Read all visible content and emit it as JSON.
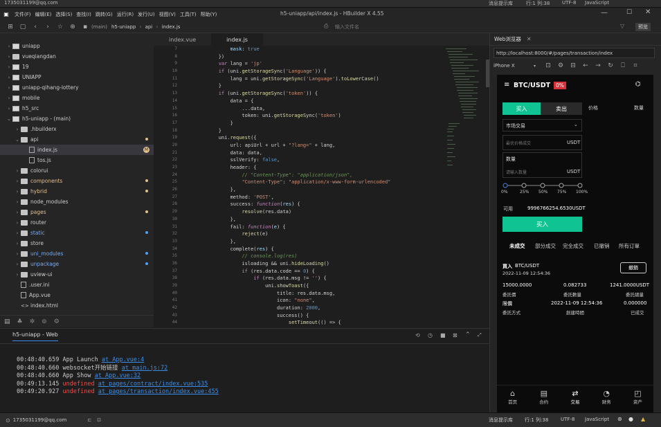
{
  "titlebar": {
    "left_text": "1735031199@qq.com",
    "hint": "消息提示库",
    "pos": "行:1  列:38",
    "encoding": "UTF-8",
    "lang": "JavaScript"
  },
  "menu": {
    "items": [
      "文件(F)",
      "编辑(E)",
      "选择(S)",
      "查找(I)",
      "跳转(G)",
      "运行(R)",
      "发行(U)",
      "视图(V)",
      "工具(T)",
      "帮助(Y)"
    ],
    "window_title": "h5-uniapp/api/index.js - HBuilder X 4.55"
  },
  "toolbar": {
    "crumbs": [
      "(main)",
      "h5-uniapp",
      "api",
      "index.js"
    ],
    "search_placeholder": "输入文件名",
    "right_btn": "预览"
  },
  "tree": [
    {
      "label": "uniapp",
      "depth": 0,
      "open": false,
      "type": "project"
    },
    {
      "label": "vueqiangdan",
      "depth": 0,
      "open": false,
      "type": "folder"
    },
    {
      "label": "19",
      "depth": 0,
      "open": false,
      "type": "project"
    },
    {
      "label": "UNIAPP",
      "depth": 0,
      "open": false,
      "type": "project"
    },
    {
      "label": "uniapp-qihang-lottery",
      "depth": 0,
      "open": false,
      "type": "project"
    },
    {
      "label": "mobile",
      "depth": 0,
      "open": false,
      "type": "project"
    },
    {
      "label": "h5_src",
      "depth": 0,
      "open": false,
      "type": "project"
    },
    {
      "label": "h5-uniapp - (main)",
      "depth": 0,
      "open": true,
      "type": "project"
    },
    {
      "label": ".hbuilderx",
      "depth": 1,
      "open": false,
      "type": "folder"
    },
    {
      "label": "api",
      "depth": 1,
      "open": true,
      "type": "folder",
      "dot": "#e2c08d"
    },
    {
      "label": "index.js",
      "depth": 2,
      "type": "file",
      "selected": true,
      "badge": "M"
    },
    {
      "label": "tos.js",
      "depth": 2,
      "type": "file"
    },
    {
      "label": "colorui",
      "depth": 1,
      "open": false,
      "type": "folder"
    },
    {
      "label": "components",
      "depth": 1,
      "open": false,
      "type": "folder",
      "dot": "#e2c08d",
      "color": "#e2c08d"
    },
    {
      "label": "hybrid",
      "depth": 1,
      "open": false,
      "type": "folder",
      "dot": "#e2c08d",
      "color": "#e2c08d"
    },
    {
      "label": "node_modules",
      "depth": 1,
      "open": false,
      "type": "folder"
    },
    {
      "label": "pages",
      "depth": 1,
      "open": false,
      "type": "folder",
      "dot": "#e2c08d",
      "color": "#e2c08d"
    },
    {
      "label": "router",
      "depth": 1,
      "open": false,
      "type": "folder"
    },
    {
      "label": "static",
      "depth": 1,
      "open": false,
      "type": "folder",
      "dot": "#4ea1f3",
      "color": "#7aaaf0"
    },
    {
      "label": "store",
      "depth": 1,
      "open": false,
      "type": "folder"
    },
    {
      "label": "uni_modules",
      "depth": 1,
      "open": false,
      "type": "folder",
      "dot": "#4ea1f3",
      "color": "#7aaaf0"
    },
    {
      "label": "unpackage",
      "depth": 1,
      "open": false,
      "type": "folder",
      "dot": "#4ea1f3",
      "color": "#7aaaf0"
    },
    {
      "label": "uview-ui",
      "depth": 1,
      "open": false,
      "type": "folder"
    },
    {
      "label": ".user.ini",
      "depth": 1,
      "type": "file"
    },
    {
      "label": "App.vue",
      "depth": 1,
      "type": "file"
    },
    {
      "label": "index.html",
      "depth": 1,
      "type": "html"
    }
  ],
  "tabs": [
    "index.vue",
    "index.js"
  ],
  "code": {
    "line_numbers": [
      "7",
      "8",
      "9",
      "10",
      "11",
      "12",
      "13",
      "14",
      "15",
      "16",
      "17",
      "18",
      "19",
      "20",
      "21",
      "22",
      "23",
      "24",
      "25",
      "26",
      "27",
      "28",
      "29",
      "30",
      "31",
      "32",
      "33",
      "34",
      "35",
      "36",
      "37",
      "38",
      "39",
      "40",
      "41",
      "42",
      "43",
      "44"
    ],
    "lines": [
      [
        [
          "            ",
          "p"
        ],
        [
          "mask",
          "k"
        ],
        [
          ": ",
          "p"
        ],
        [
          "true",
          "n"
        ]
      ],
      [
        [
          "        })",
          "p"
        ]
      ],
      [
        [
          "        ",
          "p"
        ],
        [
          "var",
          "k2"
        ],
        [
          " lang = ",
          "p"
        ],
        [
          "'jp'",
          "s"
        ]
      ],
      [
        [
          "        ",
          "p"
        ],
        [
          "if",
          "k2"
        ],
        [
          " (uni.",
          "p"
        ],
        [
          "getStorageSync",
          "f"
        ],
        [
          "(",
          "p"
        ],
        [
          "'Language'",
          "s"
        ],
        [
          ")) {",
          "p"
        ]
      ],
      [
        [
          "            lang = uni.",
          "p"
        ],
        [
          "getStorageSync",
          "f"
        ],
        [
          "(",
          "p"
        ],
        [
          "'Language'",
          "s"
        ],
        [
          ").",
          "p"
        ],
        [
          "toLowerCase",
          "f"
        ],
        [
          "()",
          "p"
        ]
      ],
      [
        [
          "        }",
          "p"
        ]
      ],
      [
        [
          "        ",
          "p"
        ],
        [
          "if",
          "k2"
        ],
        [
          " (uni.",
          "p"
        ],
        [
          "getStorageSync",
          "f"
        ],
        [
          "(",
          "p"
        ],
        [
          "'token'",
          "s"
        ],
        [
          ")) {",
          "p"
        ]
      ],
      [
        [
          "            data = {",
          "p"
        ]
      ],
      [
        [
          "                ...data,",
          "p"
        ]
      ],
      [
        [
          "                token: uni.",
          "p"
        ],
        [
          "getStorageSync",
          "f"
        ],
        [
          "(",
          "p"
        ],
        [
          "'token'",
          "s"
        ],
        [
          ")",
          "p"
        ]
      ],
      [
        [
          "            }",
          "p"
        ]
      ],
      [
        [
          "        }",
          "p"
        ]
      ],
      [
        [
          "        uni.",
          "p"
        ],
        [
          "request",
          "f"
        ],
        [
          "({",
          "p"
        ]
      ],
      [
        [
          "            url: apiUrl + url + ",
          "p"
        ],
        [
          "\"?lang=\"",
          "s"
        ],
        [
          " + lang,",
          "p"
        ]
      ],
      [
        [
          "            data: data,",
          "p"
        ]
      ],
      [
        [
          "            sslVerify: ",
          "p"
        ],
        [
          "false",
          "n"
        ],
        [
          ",",
          "p"
        ]
      ],
      [
        [
          "            header: {",
          "p"
        ]
      ],
      [
        [
          "                ",
          "p"
        ],
        [
          "// \"Content-Type\": \"application/json\",",
          "c"
        ]
      ],
      [
        [
          "                ",
          "p"
        ],
        [
          "\"Content-Type\"",
          "s"
        ],
        [
          ": ",
          "p"
        ],
        [
          "\"application/x-www-form-urlencoded\"",
          "s"
        ]
      ],
      [
        [
          "            },",
          "p"
        ]
      ],
      [
        [
          "            method: ",
          "p"
        ],
        [
          "'POST'",
          "s"
        ],
        [
          ",",
          "p"
        ]
      ],
      [
        [
          "            success: ",
          "p"
        ],
        [
          "function",
          "k2"
        ],
        [
          "(",
          "p"
        ],
        [
          "res",
          "v"
        ],
        [
          ") {",
          "p"
        ]
      ],
      [
        [
          "                ",
          "p"
        ],
        [
          "resolve",
          "f"
        ],
        [
          "(res.data)",
          "p"
        ]
      ],
      [
        [
          "            },",
          "p"
        ]
      ],
      [
        [
          "            fail: ",
          "p"
        ],
        [
          "function",
          "k2"
        ],
        [
          "(",
          "p"
        ],
        [
          "e",
          "v"
        ],
        [
          ") {",
          "p"
        ]
      ],
      [
        [
          "                ",
          "p"
        ],
        [
          "reject",
          "f"
        ],
        [
          "(e)",
          "p"
        ]
      ],
      [
        [
          "            },",
          "p"
        ]
      ],
      [
        [
          "            complete(",
          "p"
        ],
        [
          "res",
          "v"
        ],
        [
          ") {",
          "p"
        ]
      ],
      [
        [
          "                ",
          "p"
        ],
        [
          "// console.log(res)",
          "c"
        ]
      ],
      [
        [
          "                isloading && uni.",
          "p"
        ],
        [
          "hideLoading",
          "f"
        ],
        [
          "()",
          "p"
        ]
      ],
      [
        [
          "                ",
          "p"
        ],
        [
          "if",
          "k2"
        ],
        [
          " (res.data.code == ",
          "p"
        ],
        [
          "0",
          "n"
        ],
        [
          ") {",
          "p"
        ]
      ],
      [
        [
          "                    ",
          "p"
        ],
        [
          "if",
          "k2"
        ],
        [
          " (res.data.msg != ",
          "p"
        ],
        [
          "''",
          "s"
        ],
        [
          ") {",
          "p"
        ]
      ],
      [
        [
          "                        uni.",
          "p"
        ],
        [
          "showToast",
          "f"
        ],
        [
          "({",
          "p"
        ]
      ],
      [
        [
          "                            title: res.data.msg,",
          "p"
        ]
      ],
      [
        [
          "                            icon: ",
          "p"
        ],
        [
          "\"none\"",
          "s"
        ],
        [
          ",",
          "p"
        ]
      ],
      [
        [
          "                            duration: ",
          "p"
        ],
        [
          "2000",
          "n"
        ],
        [
          ",",
          "p"
        ]
      ],
      [
        [
          "                            success() {",
          "p"
        ]
      ],
      [
        [
          "                                ",
          "p"
        ],
        [
          "setTimeout",
          "f"
        ],
        [
          "(() => {",
          "p"
        ]
      ]
    ]
  },
  "console": {
    "title": "h5-uniapp - Web",
    "logs": [
      {
        "time": "00:48:40.659",
        "msg": "App Launch",
        "link": "at App.vue:4",
        "err": false
      },
      {
        "time": "00:48:40.660",
        "msg": "websocket开始链接",
        "link": "at main.js:72",
        "err": false
      },
      {
        "time": "00:48:40.660",
        "msg": "App Show",
        "link": "at App.vue:32",
        "err": false
      },
      {
        "time": "00:49:13.145",
        "msg": "undefined",
        "link": "at pages/contract/index.vue:535",
        "err": true
      },
      {
        "time": "00:49:20.927",
        "msg": "undefined",
        "link": "at pages/transaction/index.vue:455",
        "err": true
      }
    ]
  },
  "browser": {
    "tab": "Web浏览器",
    "url": "http://localhost:8000/#/pages/transaction/index",
    "device": "iPhone X"
  },
  "phone": {
    "pair": "BTC/USDT",
    "change": "0%",
    "buy_tab": "买入",
    "sell_tab": "卖出",
    "col_price": "价格",
    "col_qty": "数量",
    "order_type": "市场交易",
    "price_placeholder": "最优价格成交",
    "price_unit": "USDT",
    "qty_label": "数量",
    "qty_placeholder": "请输入数量",
    "qty_unit": "USDT",
    "percents": [
      "0%",
      "25%",
      "50%",
      "75%",
      "100%"
    ],
    "avail_label": "可用",
    "avail_value": "9996766254.6530USDT",
    "submit": "买入",
    "order_tabs": [
      "未成交",
      "部分成交",
      "完全成交",
      "已撤销",
      "所有订單"
    ],
    "order": {
      "side": "買入",
      "pair": "BTC/USDT",
      "time": "2022-11-09 12:54:36",
      "cancel": "撤銷",
      "v1": "15000.0000",
      "l1": "委託價",
      "v2": "0.082733",
      "l2": "委託數量",
      "v3": "1241.0000USDT",
      "l3": "委託總量",
      "v4": "限價",
      "l4": "委託方式",
      "v5": "2022-11-09 12:54:36",
      "l5": "創建時間",
      "v6": "0.000000",
      "l6": "已成交"
    },
    "nav": [
      "首页",
      "合约",
      "交易",
      "财务",
      "资产"
    ]
  },
  "colors": {
    "accent_green": "#0fc492",
    "change_red": "#d9303a",
    "link_blue": "#3b8eea",
    "err_red": "#f14c4c"
  }
}
